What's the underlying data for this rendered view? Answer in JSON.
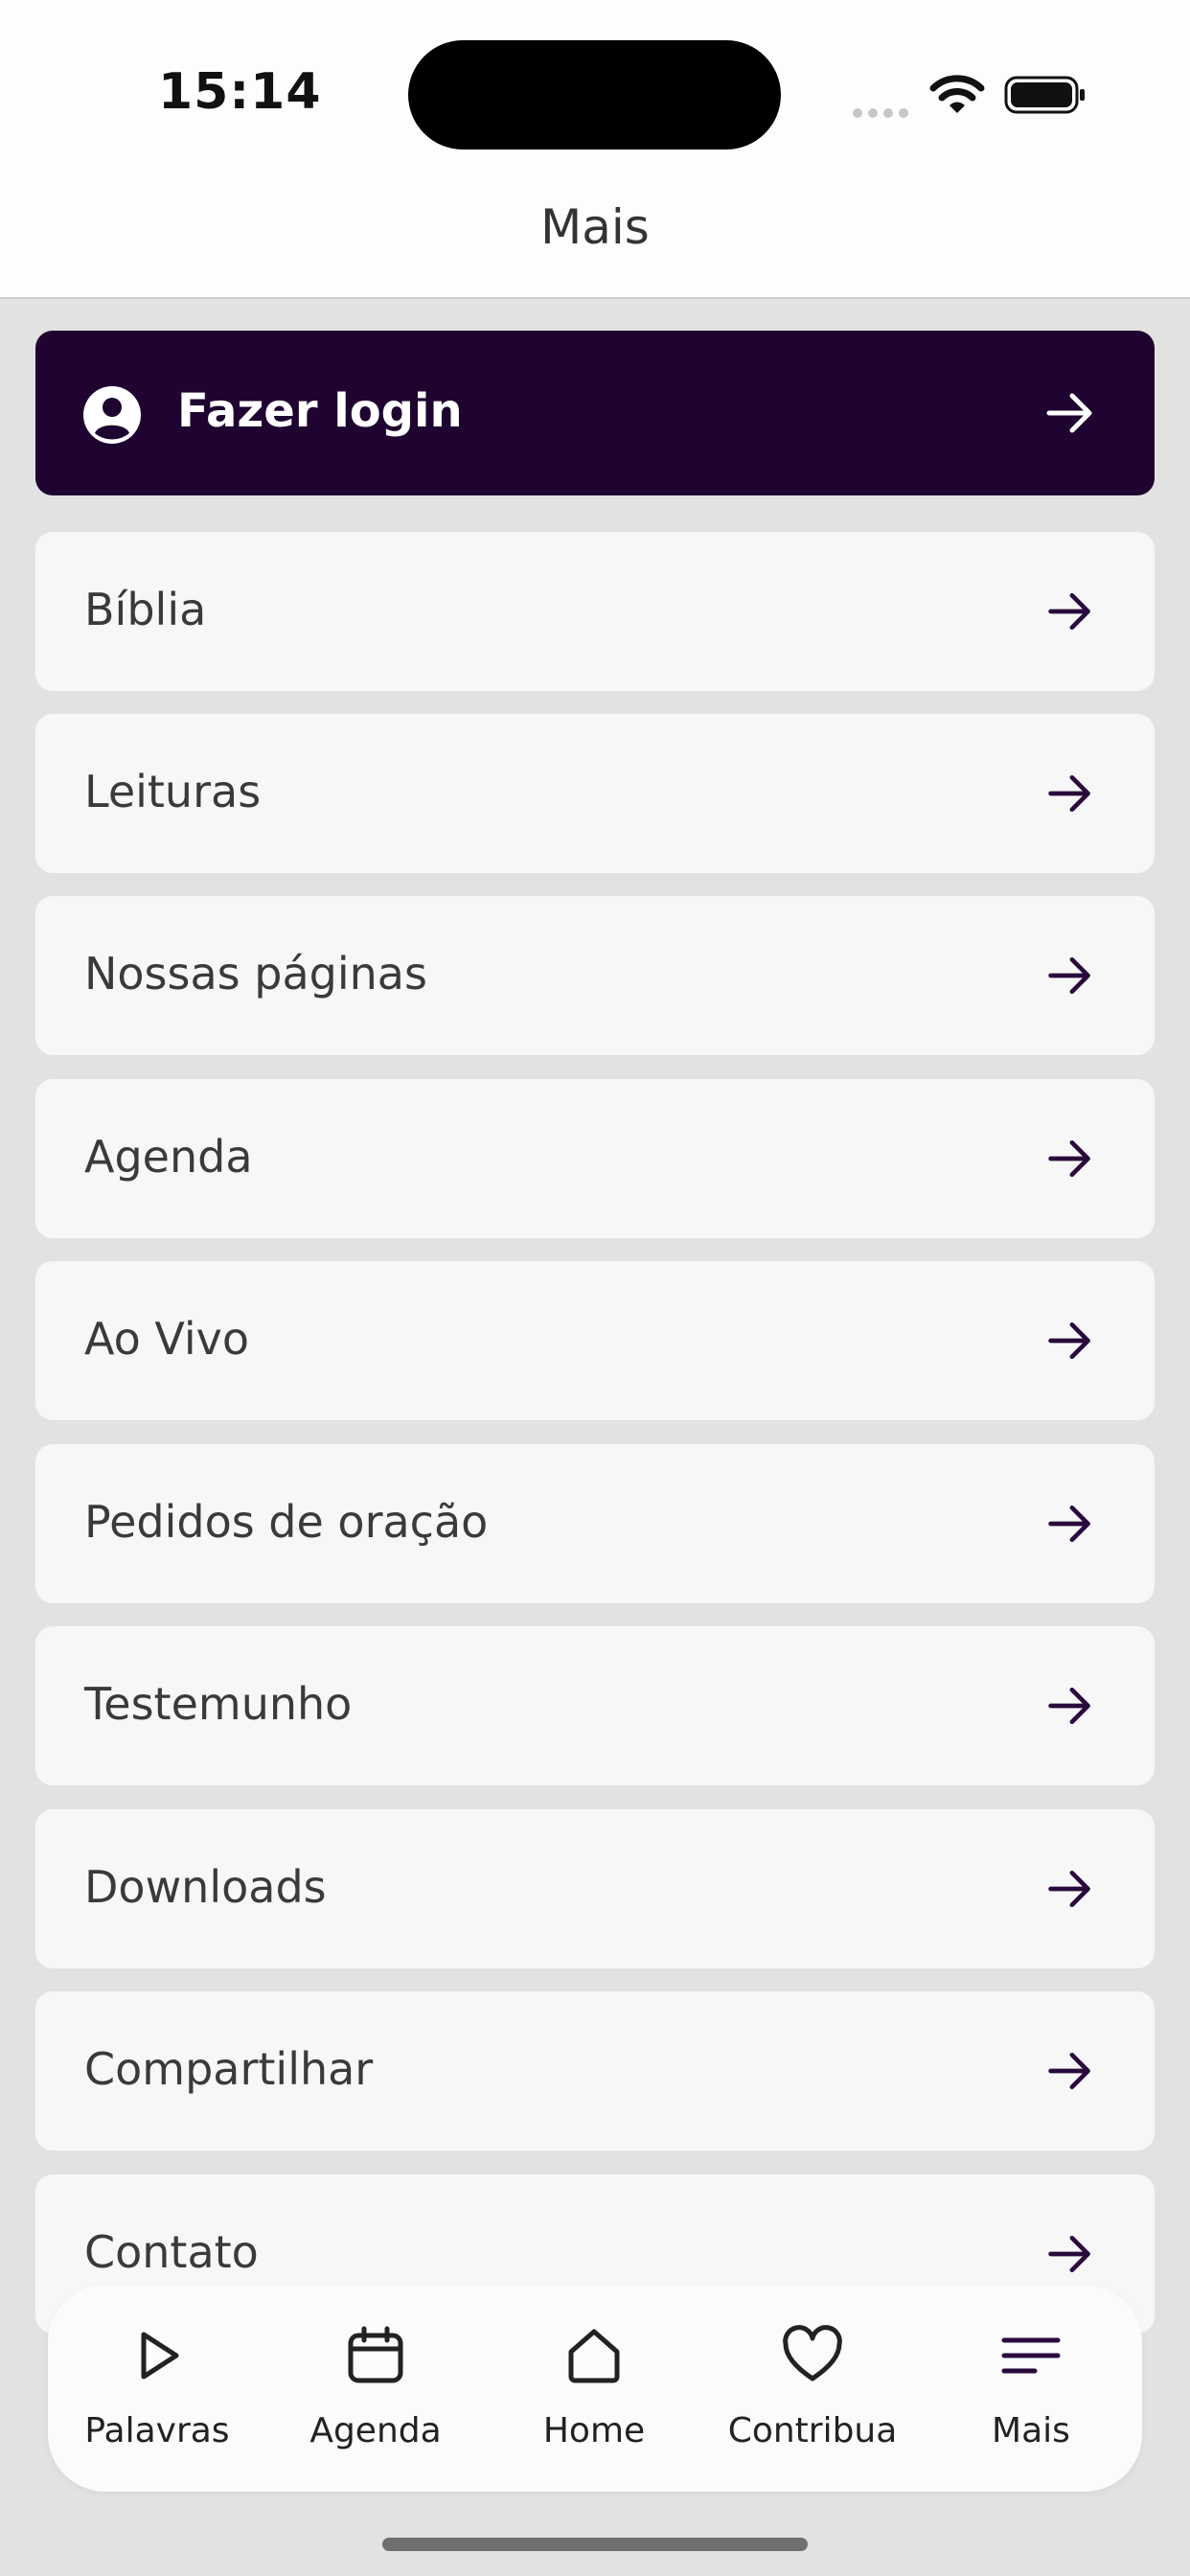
{
  "status": {
    "time": "15:14"
  },
  "header": {
    "title": "Mais"
  },
  "login": {
    "label": "Fazer login"
  },
  "menu": {
    "items": [
      {
        "label": "Bíblia"
      },
      {
        "label": "Leituras"
      },
      {
        "label": "Nossas páginas"
      },
      {
        "label": "Agenda"
      },
      {
        "label": "Ao Vivo"
      },
      {
        "label": "Pedidos de oração"
      },
      {
        "label": "Testemunho"
      },
      {
        "label": "Downloads"
      },
      {
        "label": "Compartilhar"
      },
      {
        "label": "Contato"
      }
    ]
  },
  "tabbar": {
    "tabs": [
      {
        "label": "Palavras",
        "icon": "play-icon"
      },
      {
        "label": "Agenda",
        "icon": "calendar-icon"
      },
      {
        "label": "Home",
        "icon": "home-icon"
      },
      {
        "label": "Contribua",
        "icon": "heart-icon"
      },
      {
        "label": "Mais",
        "icon": "menu-icon"
      }
    ],
    "active": "Mais"
  },
  "colors": {
    "accent": "#1f0330",
    "background": "#e2e2e2",
    "card": "#f7f7f7",
    "arrow": "#2a0a3d"
  }
}
